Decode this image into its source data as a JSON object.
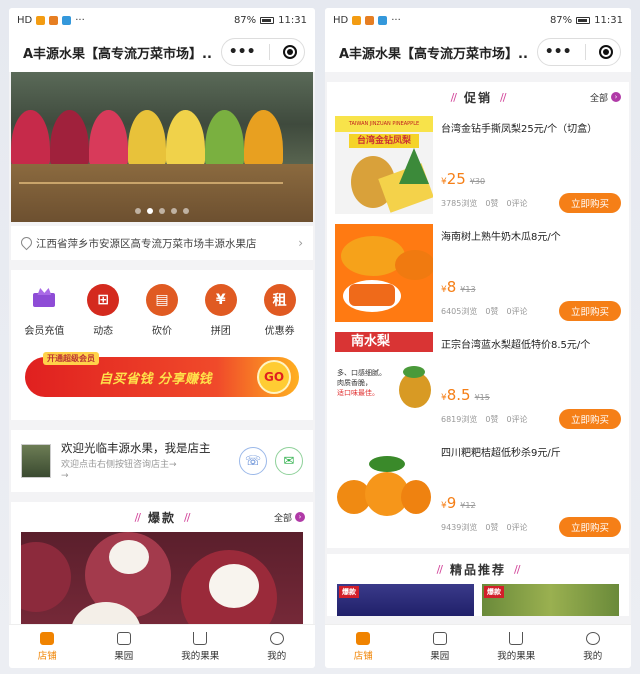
{
  "status_bar": {
    "left": "HD",
    "battery": "87%",
    "time": "11:31"
  },
  "nav_title": "A丰源水果【高专流万菜市场】...",
  "capsule": {
    "more": "•••"
  },
  "address": "江西省萍乡市安源区高专流万菜市场丰源水果店",
  "grid_items": [
    {
      "label": "会员充值",
      "glyph": "",
      "color": "#8e4cd6"
    },
    {
      "label": "动态",
      "glyph": "⊞",
      "color": "#d42a1e"
    },
    {
      "label": "砍价",
      "glyph": "▤",
      "color": "#e05a22"
    },
    {
      "label": "拼团",
      "glyph": "¥",
      "color": "#e05a22"
    },
    {
      "label": "优惠券",
      "glyph": "租",
      "color": "#e05a22"
    }
  ],
  "promo_banner": {
    "tag": "开通超级会员",
    "slogan": "自买省钱 分享赚钱",
    "go": "GO"
  },
  "welcome": {
    "title": "欢迎光临丰源水果，我是店主",
    "subtitle": "欢迎点击右侧按钮咨询店主→",
    "subtitle2": "→"
  },
  "hot_section": {
    "title": "爆款",
    "all": "全部"
  },
  "promo_section": {
    "title": "促销",
    "all": "全部"
  },
  "featured_section": {
    "title": "精品推荐"
  },
  "products": [
    {
      "name": "台湾金钻手撕凤梨25元/个（切盒）",
      "price": "25",
      "old": "¥30",
      "views": "3785浏览",
      "likes": "0赞",
      "comments": "0评论",
      "buy": "立即购买",
      "img_head": "TAIWAN JINZUAN PINEAPPLE",
      "img_banner": "台湾金钻凤梨"
    },
    {
      "name": "海南树上熟牛奶木瓜8元/个",
      "price": "8",
      "old": "¥13",
      "views": "6405浏览",
      "likes": "0赞",
      "comments": "0评论",
      "buy": "立即购买"
    },
    {
      "name": "正宗台湾蓝水梨超低特价8.5元/个",
      "price": "8.5",
      "old": "¥15",
      "views": "6819浏览",
      "likes": "0赞",
      "comments": "0评论",
      "buy": "立即购买",
      "img_head": "南水梨",
      "img_l1": "多、口感细腻。",
      "img_l2": "肉质香脆，",
      "img_l3": "适口味最佳。"
    },
    {
      "name": "四川粑粑桔超低秒杀9元/斤",
      "price": "9",
      "old": "¥12",
      "views": "9439浏览",
      "likes": "0赞",
      "comments": "0评论",
      "buy": "立即购买"
    }
  ],
  "price_symbol": "¥",
  "featured_tag": "爆款",
  "tabs": [
    {
      "label": "店铺",
      "active": true
    },
    {
      "label": "果园",
      "active": false
    },
    {
      "label": "我的果果",
      "active": false
    },
    {
      "label": "我的",
      "active": false
    }
  ],
  "banner_dots": 5,
  "banner_active_dot": 1
}
